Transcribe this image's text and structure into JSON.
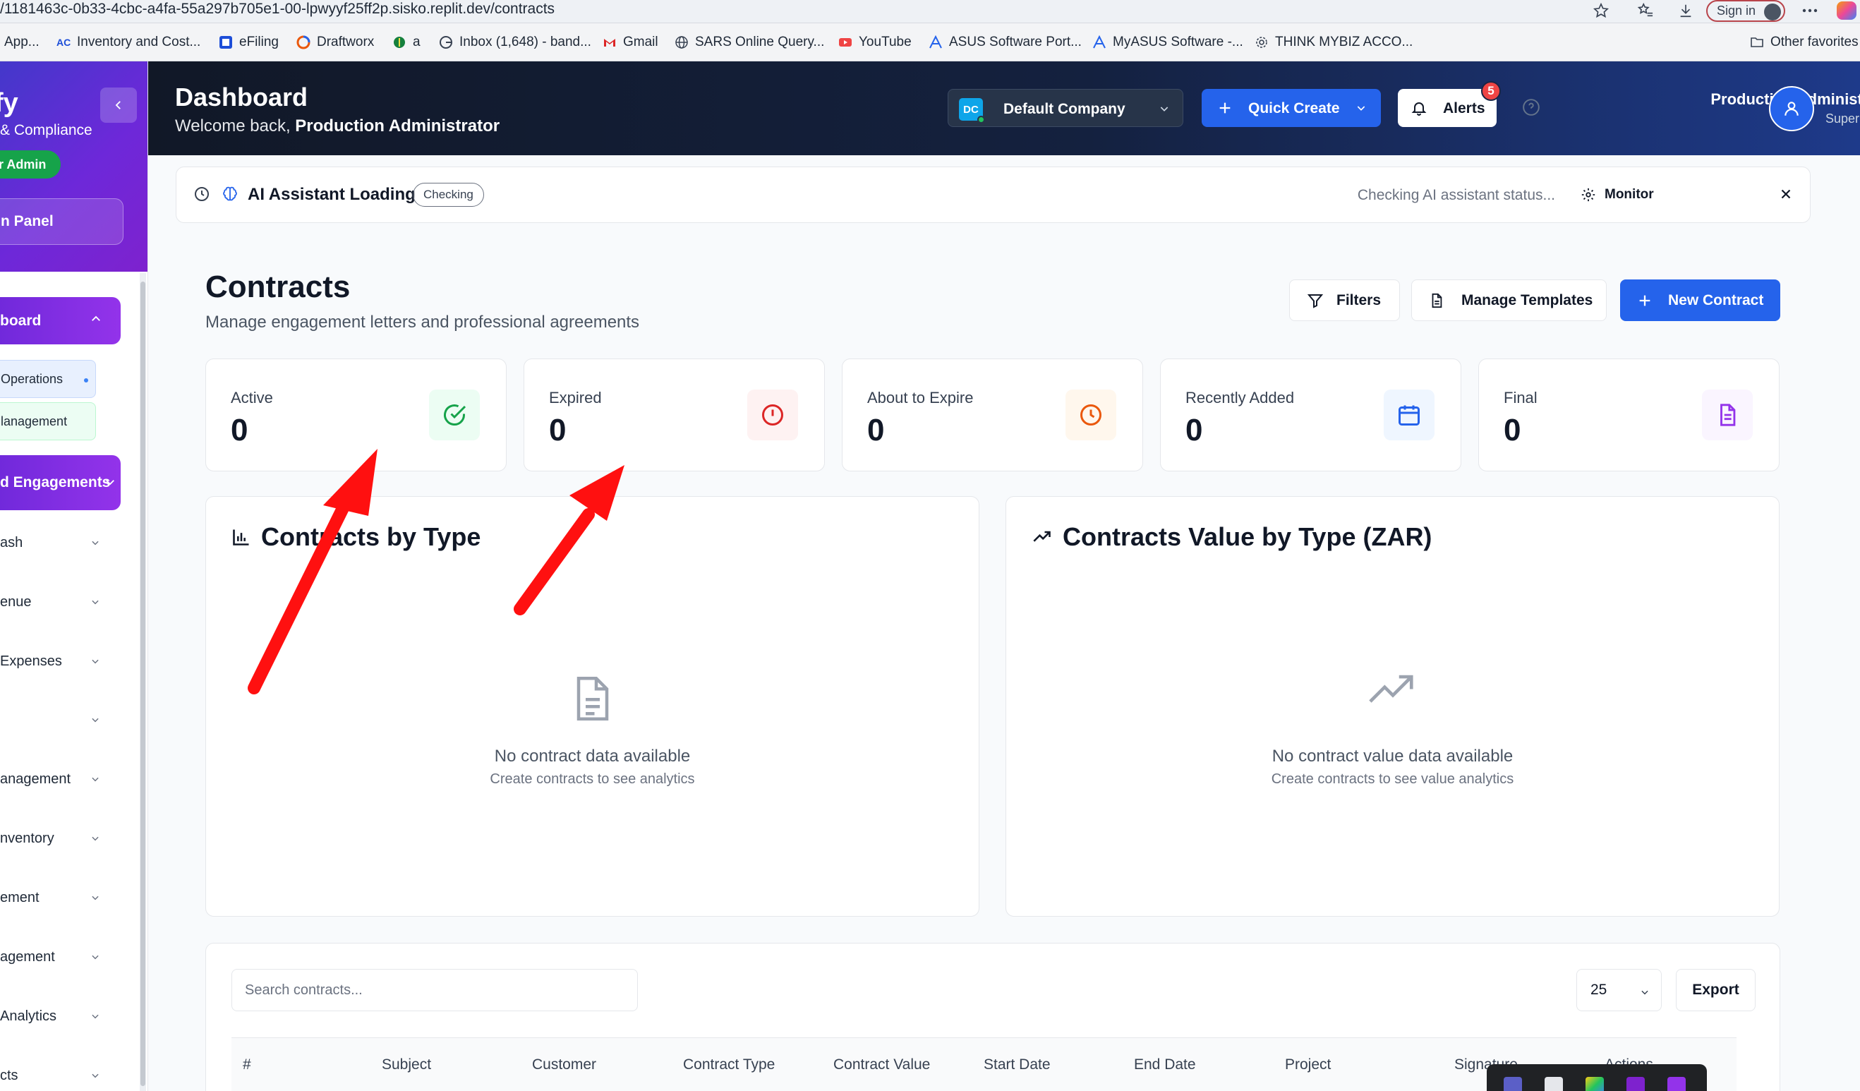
{
  "browser": {
    "url": "/1181463c-0b33-4cbc-a4fa-55a297b705e1-00-lpwyyf25ff2p.sisko.replit.dev/contracts",
    "sign_in": "Sign in",
    "bookmarks": [
      "App...",
      "Inventory and Cost...",
      "eFiling",
      "Draftworx",
      "a",
      "Inbox (1,648) - band...",
      "Gmail",
      "SARS Online Query...",
      "YouTube",
      "ASUS Software Port...",
      "MyASUS Software -...",
      "THINK MYBIZ ACCO...",
      "Other favorites"
    ]
  },
  "sidebar": {
    "brand": "fy",
    "subtitle": "& Compliance",
    "admin_badge": "r Admin",
    "panel_button": "n Panel",
    "dashboard": "board",
    "dash_items": [
      "Operations",
      "lanagement"
    ],
    "engagements": "d Engagements",
    "items": [
      "ash",
      "enue",
      " Expenses",
      "",
      "anagement",
      "nventory",
      "ement",
      "agement",
      " Analytics",
      "cts"
    ]
  },
  "topbar": {
    "title": "Dashboard",
    "welcome_prefix": "Welcome back, ",
    "welcome_name": "Production Administrator",
    "company_initials": "DC",
    "company": "Default Company",
    "quick_create": "Quick Create",
    "alerts": "Alerts",
    "alerts_count": "5",
    "user_name": "Production Administrator",
    "user_role": "Super Admin"
  },
  "ai_banner": {
    "title": "AI Assistant Loading",
    "status": "Checking",
    "checking_text": "Checking AI assistant status...",
    "monitor": "Monitor"
  },
  "contracts": {
    "title": "Contracts",
    "subtitle": "Manage engagement letters and professional agreements",
    "filters": "Filters",
    "manage_templates": "Manage Templates",
    "new_contract": "New Contract"
  },
  "stats": [
    {
      "label": "Active",
      "value": "0"
    },
    {
      "label": "Expired",
      "value": "0"
    },
    {
      "label": "About to Expire",
      "value": "0"
    },
    {
      "label": "Recently Added",
      "value": "0"
    },
    {
      "label": "Final",
      "value": "0"
    }
  ],
  "colors": {
    "primary": "#2563eb",
    "active": "#16a34a",
    "expired": "#dc2626",
    "about_to_expire": "#ea580c",
    "recently_added": "#2563eb",
    "final": "#9333ea",
    "annotation_arrow": "#ff1010"
  },
  "charts": {
    "by_type": {
      "title": "Contracts by Type",
      "empty_title": "No contract data available",
      "empty_sub": "Create contracts to see analytics"
    },
    "value_by_type": {
      "title": "Contracts Value by Type (ZAR)",
      "empty_title": "No contract value data available",
      "empty_sub": "Create contracts to see value analytics"
    }
  },
  "table": {
    "search_placeholder": "Search contracts...",
    "page_size": "25",
    "export": "Export",
    "columns": [
      "#",
      "Subject",
      "Customer",
      "Contract Type",
      "Contract Value",
      "Start Date",
      "End Date",
      "Project",
      "Signature",
      "Actions"
    ]
  }
}
